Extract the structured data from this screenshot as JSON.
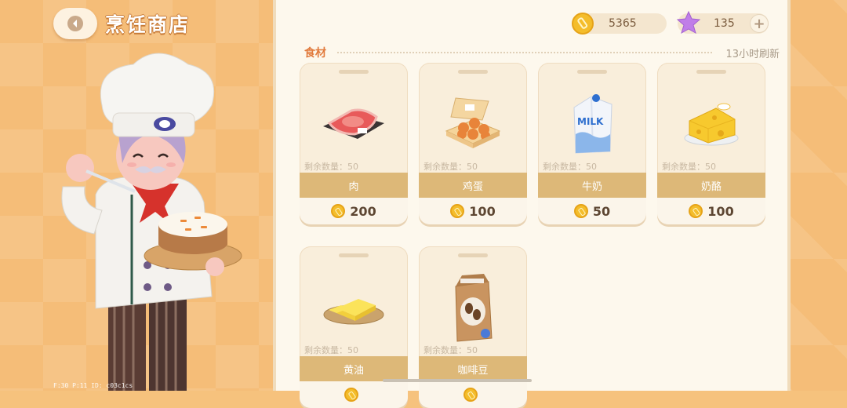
{
  "header": {
    "title": "烹饪商店"
  },
  "currency": {
    "coins": "5365",
    "stars": "135",
    "add_label": "+"
  },
  "section": {
    "label": "食材",
    "refresh": "13小时刷新"
  },
  "items": [
    {
      "name": "肉",
      "remaining": "剩余数量：50",
      "price": "200",
      "icon": "meat-icon"
    },
    {
      "name": "鸡蛋",
      "remaining": "剩余数量：50",
      "price": "100",
      "icon": "egg-carton-icon"
    },
    {
      "name": "牛奶",
      "remaining": "剩余数量：50",
      "price": "50",
      "icon": "milk-carton-icon"
    },
    {
      "name": "奶酪",
      "remaining": "剩余数量：50",
      "price": "100",
      "icon": "cheese-icon"
    },
    {
      "name": "黄油",
      "remaining": "剩余数量：50",
      "price": "",
      "icon": "butter-icon"
    },
    {
      "name": "咖啡豆",
      "remaining": "剩余数量：50",
      "price": "",
      "icon": "coffee-bag-icon"
    }
  ],
  "debug": "F:30  P:11  ID: c03c1cs",
  "colors": {
    "panel": "#fdf8ed",
    "name_band": "#ddb878",
    "coin": "#f4bd2b",
    "section": "#e17a3c"
  }
}
